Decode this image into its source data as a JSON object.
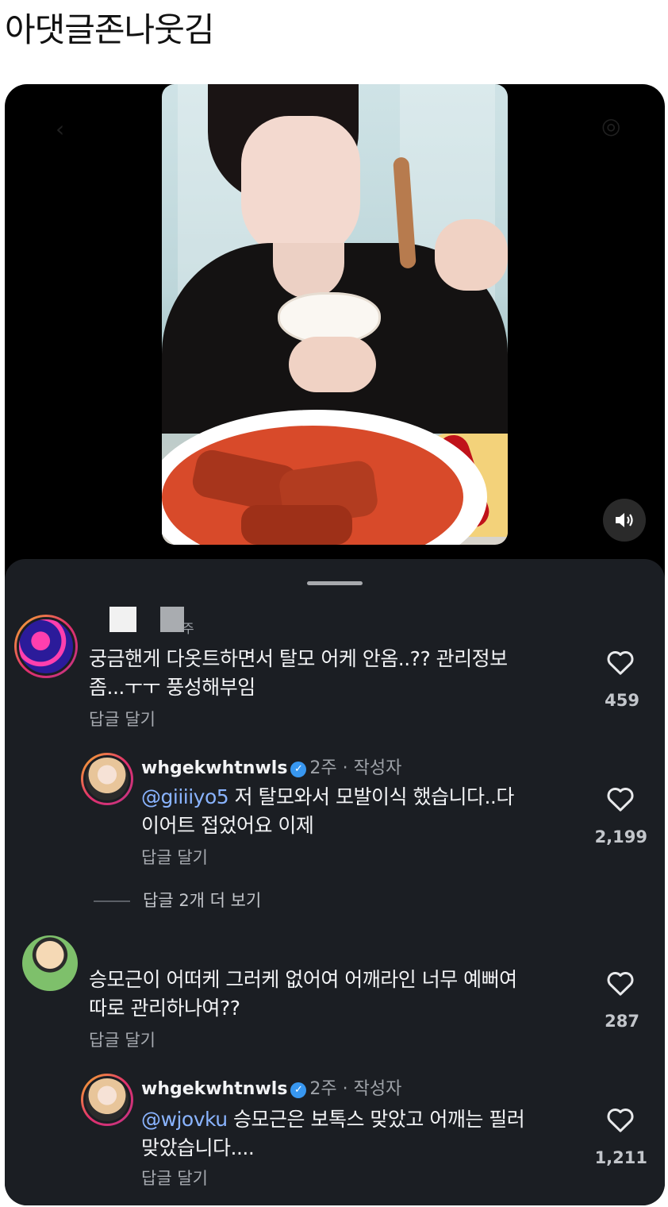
{
  "post_title": "아댓글존나웃김",
  "video": {
    "volume_icon": "speaker-icon"
  },
  "comments": [
    {
      "username": "",
      "meta": "주",
      "text": "궁금핸게 다옷트하면서 탈모 어케 안옴..?? 관리정보 좀...ㅜㅜ 풍성해부임",
      "text_line1": "궁금핸게 다옷트하면서 탈모 어케 안옴..?? 관리정보",
      "text_line2": "좀...ㅜㅜ 풍성해부임",
      "reply_label": "답글 달기",
      "likes": "459"
    },
    {
      "username": "whgekwhtnwls",
      "meta": "2주 · 작성자",
      "mention": "@giiiiyo5",
      "text_line1": " 저 탈모와서 모발이식 했습니다..다",
      "text_line2": "이어트 접었어요 이제",
      "reply_label": "답글 달기",
      "likes": "2,199"
    },
    {
      "more_replies": "답글 2개 더 보기"
    },
    {
      "username": "",
      "text_line1": "승모근이 어떠케 그러케 없어여 어깨라인 너무 예뻐여",
      "text_line2": "따로 관리하나여??",
      "reply_label": "답글 달기",
      "likes": "287"
    },
    {
      "username": "whgekwhtnwls",
      "meta": "2주 · 작성자",
      "mention": "@wjovku",
      "text_line1": " 승모근은 보톡스 맞았고 어깨는 필러",
      "text_line2": "맞았습니다....",
      "reply_label": "답글 달기",
      "likes": "1,211"
    }
  ],
  "colors": {
    "sheet_bg": "#1b1e23",
    "mention": "#8ab4ff",
    "verified": "#3897f0"
  }
}
